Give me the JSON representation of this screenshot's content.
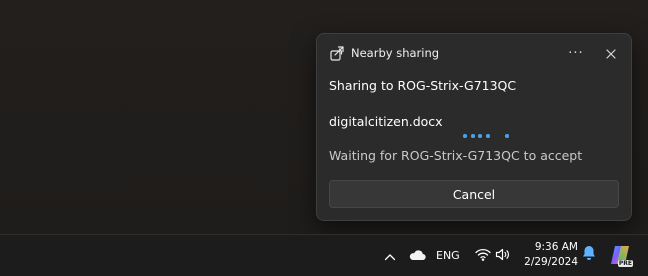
{
  "toast": {
    "app_name": "Nearby sharing",
    "app_icon": "share-icon",
    "more_label": "···",
    "sharing_to": "Sharing to ROG-Strix-G713QC",
    "file_name": "digitalcitizen.docx",
    "waiting": "Waiting for ROG-Strix-G713QC to accept",
    "cancel_label": "Cancel",
    "progress_color": "#4ca2ea"
  },
  "taskbar": {
    "tray_icons": [
      "chevron-up-icon",
      "onedrive-cloud-icon",
      "wifi-icon",
      "volume-icon",
      "notification-bell-icon",
      "copilot-icon"
    ],
    "language": "ENG",
    "time": "9:36 AM",
    "date": "2/29/2024",
    "copilot_badge": "PRE"
  }
}
